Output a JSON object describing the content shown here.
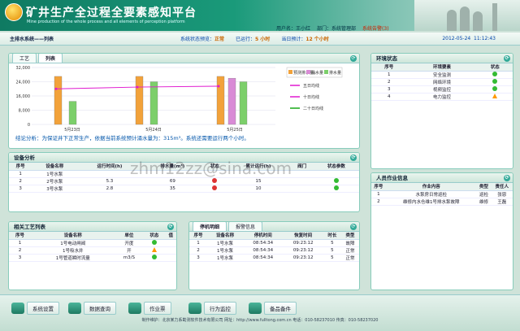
{
  "header": {
    "title": "矿井生产全过程全要素感知平台",
    "subtitle": "Mine production of the whole process and all elements of perception platform",
    "user": "用户名：王小红",
    "dept": "部门：系统管理部",
    "alert": "系统告警(3)"
  },
  "status": {
    "breadcrumb": "主排水系统——列表",
    "state_label": "系统状态预览：",
    "state_value": "正常",
    "ran_label": "已运行：",
    "ran_value": "5 小时",
    "plan_label": "当日预计：",
    "plan_value": "12 个小时",
    "date": "2012-05-24",
    "time": "11:12:43"
  },
  "chart_panel": {
    "tab1": "工艺",
    "tab2": "列表",
    "conclusion": "结论分析：为保证井下正常生产，依据当前系统预计涌水量为：315m³。系统还需要运行两个小时。"
  },
  "chart_data": {
    "type": "bar",
    "categories": [
      "5月23日",
      "5月24日",
      "5月25日"
    ],
    "ylim": [
      0,
      32000
    ],
    "yticks": [
      "32,000",
      "24,000",
      "16,000",
      "8,000",
      "0"
    ],
    "series": [
      {
        "name": "预测排水量",
        "values": [
          27000,
          27000,
          27000
        ],
        "color": "#f2a23a"
      },
      {
        "name": "涌水量",
        "values": [
          null,
          null,
          26000
        ],
        "color": "#d98bd6"
      },
      {
        "name": "排水量",
        "values": [
          13000,
          24000,
          24000
        ],
        "color": "#7ccf6a"
      }
    ],
    "lines": [
      {
        "name": "五日均线",
        "color": "#e01ad0",
        "values": [
          20000,
          21000,
          21500
        ]
      },
      {
        "name": "十日均线",
        "color": "#e01ad0"
      },
      {
        "name": "二十日均线",
        "color": "#18a818"
      }
    ]
  },
  "equipment": {
    "title": "设备分析",
    "headers": [
      "序号",
      "设备名称",
      "运行时间(h)",
      "排水量(m³)",
      "状态",
      "累计运行(h)",
      "阀门",
      "状态参数"
    ],
    "rows": [
      [
        "1",
        "1号水泵",
        "",
        "",
        "",
        "",
        "",
        ""
      ],
      [
        "2",
        "2号水泵",
        "5.3",
        "69",
        "",
        "15",
        "",
        ""
      ],
      [
        "3",
        "3号水泵",
        "2.8",
        "35",
        "",
        "10",
        "",
        ""
      ]
    ]
  },
  "process": {
    "title": "相关工艺列表",
    "headers": [
      "序号",
      "设备名称",
      "单位",
      "状态",
      "值"
    ],
    "rows": [
      [
        "1",
        "1号电动闸阀",
        "开度",
        "",
        ""
      ],
      [
        "2",
        "1号吸水井",
        "开",
        "",
        ""
      ],
      [
        "3",
        "1号管道瞬时流量",
        "m3/S",
        "",
        ""
      ]
    ]
  },
  "shutdown": {
    "tab1": "停机明细",
    "tab2": "报警信息",
    "headers": [
      "序号",
      "设备名称",
      "停机时间",
      "恢复时间",
      "时长",
      "类型"
    ],
    "rows": [
      [
        "1",
        "1号水泵",
        "08:54:34",
        "09:23:12",
        "5",
        "故障"
      ],
      [
        "2",
        "1号水泵",
        "08:54:34",
        "09:23:12",
        "5",
        "正常"
      ],
      [
        "3",
        "1号水泵",
        "08:54:34",
        "09:23:12",
        "5",
        "正常"
      ]
    ]
  },
  "environment": {
    "title": "环境状态",
    "headers": [
      "序号",
      "环境要素",
      "状态"
    ],
    "rows": [
      [
        "1",
        "安全监测"
      ],
      [
        "2",
        "网络环境"
      ],
      [
        "3",
        "视频监控"
      ],
      [
        "4",
        "电力监控"
      ]
    ]
  },
  "personnel": {
    "title": "人员作业信息",
    "headers": [
      "序号",
      "作业内容",
      "类型",
      "责任人"
    ],
    "rows": [
      [
        "1",
        "水泵房日常巡检",
        "巡检",
        "张恩"
      ],
      [
        "2",
        "维修内水仓维1号排水泵故障",
        "维修",
        "王磊"
      ]
    ]
  },
  "nav": [
    "系统设置",
    "数据查询",
    "作业票",
    "行为监控",
    "备品备件"
  ],
  "footer": "制作维护：北京某力系勘测软件技术有限公司   网址：http://www.fulltong.com.cn   电话：010-58237010   传真：010-58237020",
  "watermark": "zhm12zz@sina.com"
}
